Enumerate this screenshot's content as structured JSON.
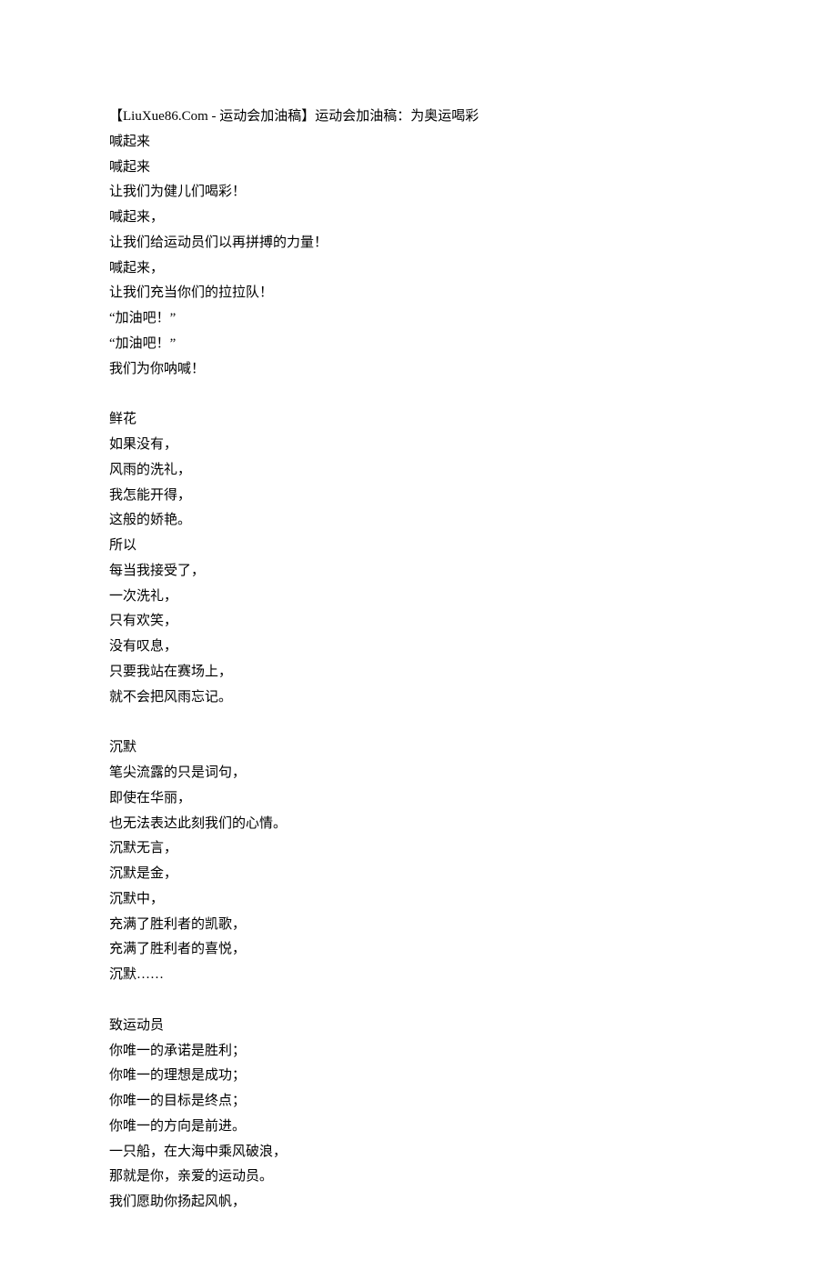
{
  "header": "【LiuXue86.Com - 运动会加油稿】运动会加油稿：为奥运喝彩",
  "sections": [
    {
      "lines": [
        "喊起来",
        "喊起来",
        "让我们为健儿们喝彩！",
        "喊起来，",
        "让我们给运动员们以再拼搏的力量！",
        "喊起来，",
        "让我们充当你们的拉拉队！",
        "“加油吧！”",
        "“加油吧！”",
        "我们为你呐喊！"
      ]
    },
    {
      "lines": [
        "鲜花",
        "如果没有，",
        "风雨的洗礼，",
        "我怎能开得，",
        "这般的娇艳。",
        "所以",
        "每当我接受了，",
        "一次洗礼，",
        "只有欢笑，",
        "没有叹息，",
        "只要我站在赛场上，",
        "就不会把风雨忘记。"
      ]
    },
    {
      "lines": [
        "沉默",
        "笔尖流露的只是词句，",
        "即使在华丽，",
        "也无法表达此刻我们的心情。",
        "沉默无言，",
        "沉默是金，",
        "沉默中，",
        "充满了胜利者的凯歌，",
        "充满了胜利者的喜悦，",
        "沉默……"
      ]
    },
    {
      "lines": [
        "致运动员",
        "你唯一的承诺是胜利；",
        "你唯一的理想是成功；",
        "你唯一的目标是终点；",
        "你唯一的方向是前进。",
        "一只船，在大海中乘风破浪，",
        "那就是你，亲爱的运动员。",
        "我们愿助你扬起风帆，"
      ]
    }
  ]
}
